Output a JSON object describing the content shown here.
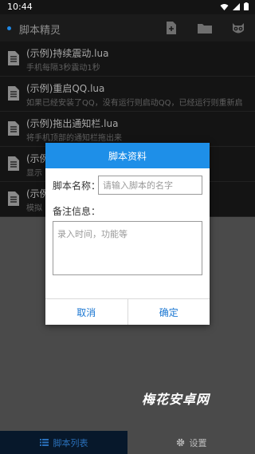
{
  "status_bar": {
    "time": "10:44",
    "icons": [
      "wifi-icon",
      "signal-icon",
      "battery-icon"
    ]
  },
  "app_bar": {
    "title": "脚本精灵",
    "actions": [
      "new-script-icon",
      "folder-icon",
      "owl-icon"
    ]
  },
  "scripts": [
    {
      "name": "(示例)持续震动.lua",
      "desc": "手机每隔3秒震动1秒"
    },
    {
      "name": "(示例)重启QQ.lua",
      "desc": "如果已经安装了QQ，没有运行则启动QQ，已经运行则重新启"
    },
    {
      "name": "(示例)拖出通知栏.lua",
      "desc": "将手机顶部的通知栏拖出来"
    },
    {
      "name": "(示例)",
      "desc": "显示"
    },
    {
      "name": "(示例)",
      "desc": "模拟"
    }
  ],
  "dialog": {
    "title": "脚本资料",
    "name_label": "脚本名称：",
    "name_placeholder": "请输入脚本的名字",
    "name_value": "",
    "note_label": "备注信息：",
    "note_placeholder": "录入时间，功能等",
    "note_value": "",
    "cancel_label": "取消",
    "confirm_label": "确定"
  },
  "watermark": "梅花安卓网",
  "bottom_nav": {
    "tabs": [
      {
        "label": "脚本列表",
        "icon": "list-icon",
        "active": true
      },
      {
        "label": "设置",
        "icon": "gear-icon",
        "active": false
      }
    ]
  },
  "colors": {
    "accent": "#1e8fe8",
    "active_tab_text": "#2a6fb8",
    "list_background": "#141414"
  }
}
